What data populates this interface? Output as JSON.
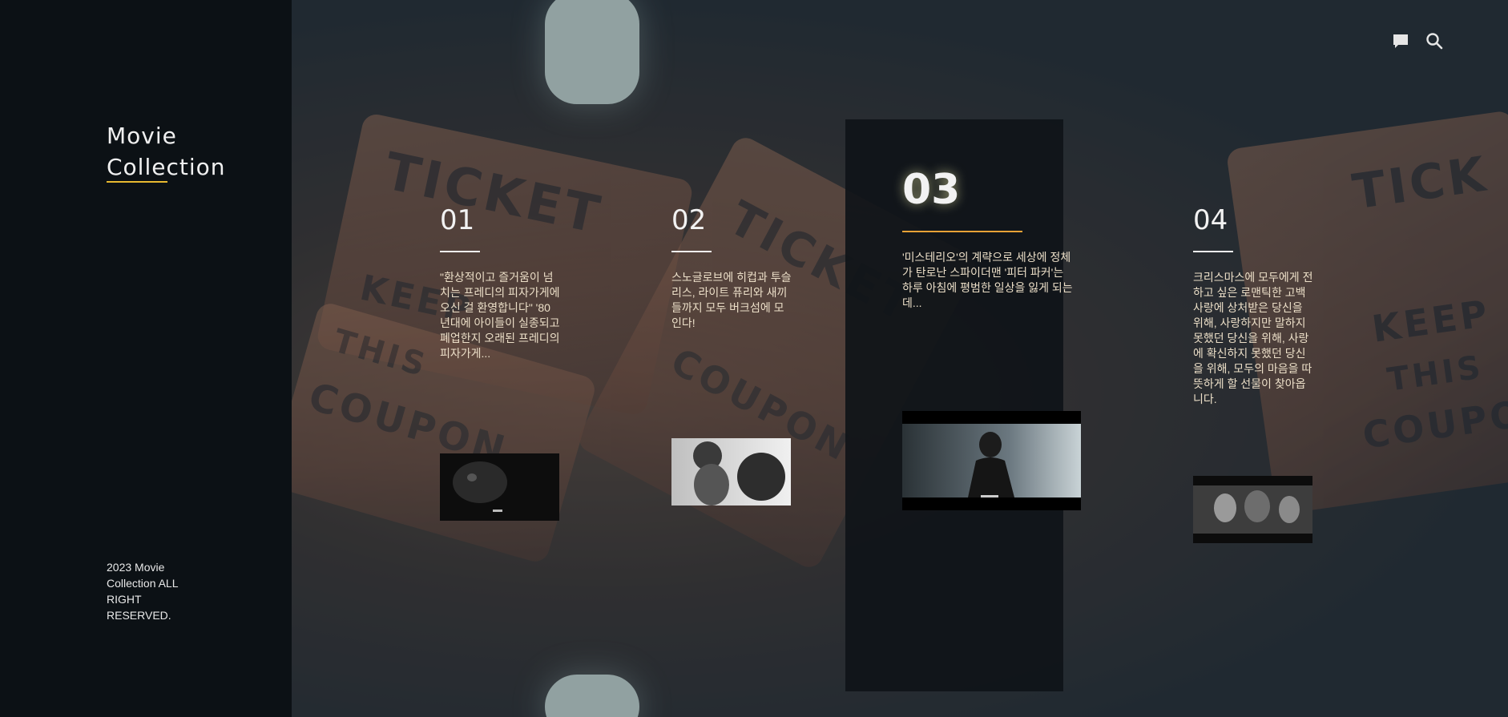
{
  "brand": {
    "title_line1": "Movie",
    "title_line2": "Collection"
  },
  "footer": {
    "copyright": "2023 Movie Collection ALL RIGHT RESERVED."
  },
  "header_icons": [
    "chat-icon",
    "search-icon"
  ],
  "accent_color": "#e8b930",
  "active_bar_color": "#e8a236",
  "movies": [
    {
      "number": "01",
      "description": "\"환상적이고 즐거움이 넘치는 프레디의 피자가게에 오신 걸 환영합니다\" '80년대에 아이들이 실종되고 폐업한지 오래된 프레디의 피자가게...",
      "active": false
    },
    {
      "number": "02",
      "description": "스노글로브에 히컵과 투슬리스, 라이트 퓨리와 새끼들까지 모두 버크섬에 모인다!",
      "active": false
    },
    {
      "number": "03",
      "description": "'미스테리오'의 계략으로 세상에 정체가 탄로난 스파이더맨 '피터 파커'는 하루 아침에 평범한 일상을 잃게 되는데...",
      "active": true
    },
    {
      "number": "04",
      "description": "크리스마스에 모두에게 전하고 싶은 로맨틱한 고백 사랑에 상처받은 당신을 위해, 사랑하지만 말하지 못했던 당신을 위해, 사랑에 확신하지 못했던 당신을 위해, 모두의 마음을 따뜻하게 할 선물이 찾아옵니다.",
      "active": false
    }
  ]
}
